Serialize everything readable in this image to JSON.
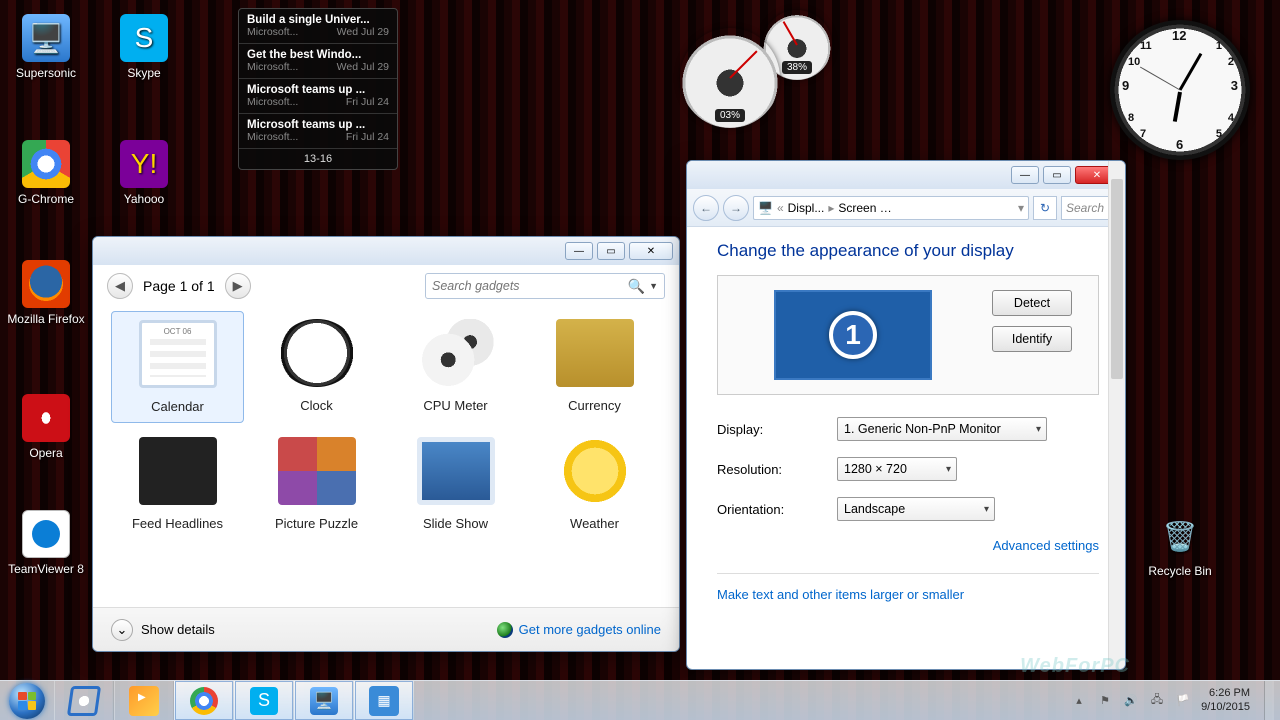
{
  "desktop": {
    "icons": [
      {
        "label": "Supersonic"
      },
      {
        "label": "Skype"
      },
      {
        "label": "G-Chrome"
      },
      {
        "label": "Yahooo"
      },
      {
        "label": "Mozilla Firefox"
      },
      {
        "label": "Opera"
      },
      {
        "label": "TeamViewer 8"
      },
      {
        "label": "Recycle Bin"
      }
    ]
  },
  "feed": {
    "items": [
      {
        "title": "Build a single Univer...",
        "src": "Microsoft...",
        "date": "Wed Jul 29"
      },
      {
        "title": "Get the best Windo...",
        "src": "Microsoft...",
        "date": "Wed Jul 29"
      },
      {
        "title": "Microsoft teams up ...",
        "src": "Microsoft...",
        "date": "Fri Jul 24"
      },
      {
        "title": "Microsoft teams up ...",
        "src": "Microsoft...",
        "date": "Fri Jul 24"
      }
    ],
    "pager": "13-16"
  },
  "cpu": {
    "big": "03%",
    "small": "38%"
  },
  "gadgets_win": {
    "pager_text": "Page 1 of 1",
    "search_placeholder": "Search gadgets",
    "items": [
      "Calendar",
      "Clock",
      "CPU Meter",
      "Currency",
      "Feed Headlines",
      "Picture Puzzle",
      "Slide Show",
      "Weather"
    ],
    "show_details": "Show details",
    "more_link": "Get more gadgets online"
  },
  "display_win": {
    "breadcrumb": {
      "a": "Displ...",
      "b": "Screen Re..."
    },
    "search_placeholder": "Search",
    "heading": "Change the appearance of your display",
    "monitor_number": "1",
    "detect": "Detect",
    "identify": "Identify",
    "display_label": "Display:",
    "display_value": "1. Generic Non-PnP Monitor",
    "resolution_label": "Resolution:",
    "resolution_value": "1280 × 720",
    "orientation_label": "Orientation:",
    "orientation_value": "Landscape",
    "advanced": "Advanced settings",
    "larger_link": "Make text and other items larger or smaller"
  },
  "taskbar": {
    "time": "6:26 PM",
    "date": "9/10/2015"
  },
  "watermark": "WebForPC"
}
